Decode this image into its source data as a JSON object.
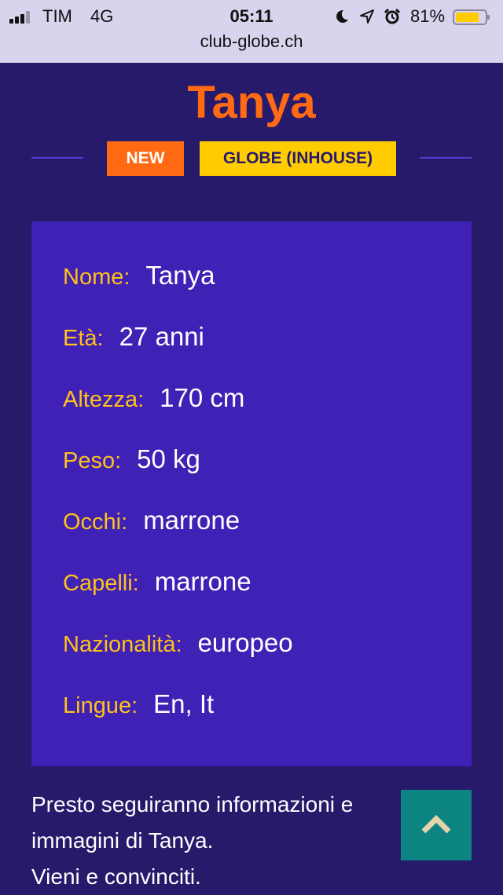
{
  "status_bar": {
    "carrier": "TIM",
    "network": "4G",
    "time": "05:11",
    "battery_percent": "81%",
    "battery_level": 0.81,
    "battery_color": "#ffcc00",
    "icons": [
      "moon-icon",
      "location-arrow-icon",
      "alarm-icon"
    ]
  },
  "browser": {
    "url": "club-globe.ch"
  },
  "profile": {
    "name": "Tanya",
    "badges": {
      "new": "NEW",
      "category": "GLOBE (INHOUSE)"
    },
    "details": [
      {
        "label": "Nome:",
        "value": "Tanya"
      },
      {
        "label": "Età:",
        "value": "27 anni"
      },
      {
        "label": "Altezza:",
        "value": "170 cm"
      },
      {
        "label": "Peso:",
        "value": "50 kg"
      },
      {
        "label": "Occhi:",
        "value": "marrone"
      },
      {
        "label": "Capelli:",
        "value": "marrone"
      },
      {
        "label": "Nazionalità:",
        "value": "europeo"
      },
      {
        "label": "Lingue:",
        "value": "En, It"
      }
    ],
    "description": {
      "line1": "Presto seguiranno informazioni e",
      "line2": "immagini di Tanya.",
      "line3": "Vieni e convinciti."
    }
  },
  "colors": {
    "background": "#271a6b",
    "card": "#3f21b5",
    "title": "#ff6a13",
    "label": "#ffc21a",
    "badge_new": "#ff6a13",
    "badge_category": "#ffcc00",
    "scroll_button": "#0b8482"
  },
  "scroll_top_button": {
    "icon": "chevron-up-icon"
  }
}
